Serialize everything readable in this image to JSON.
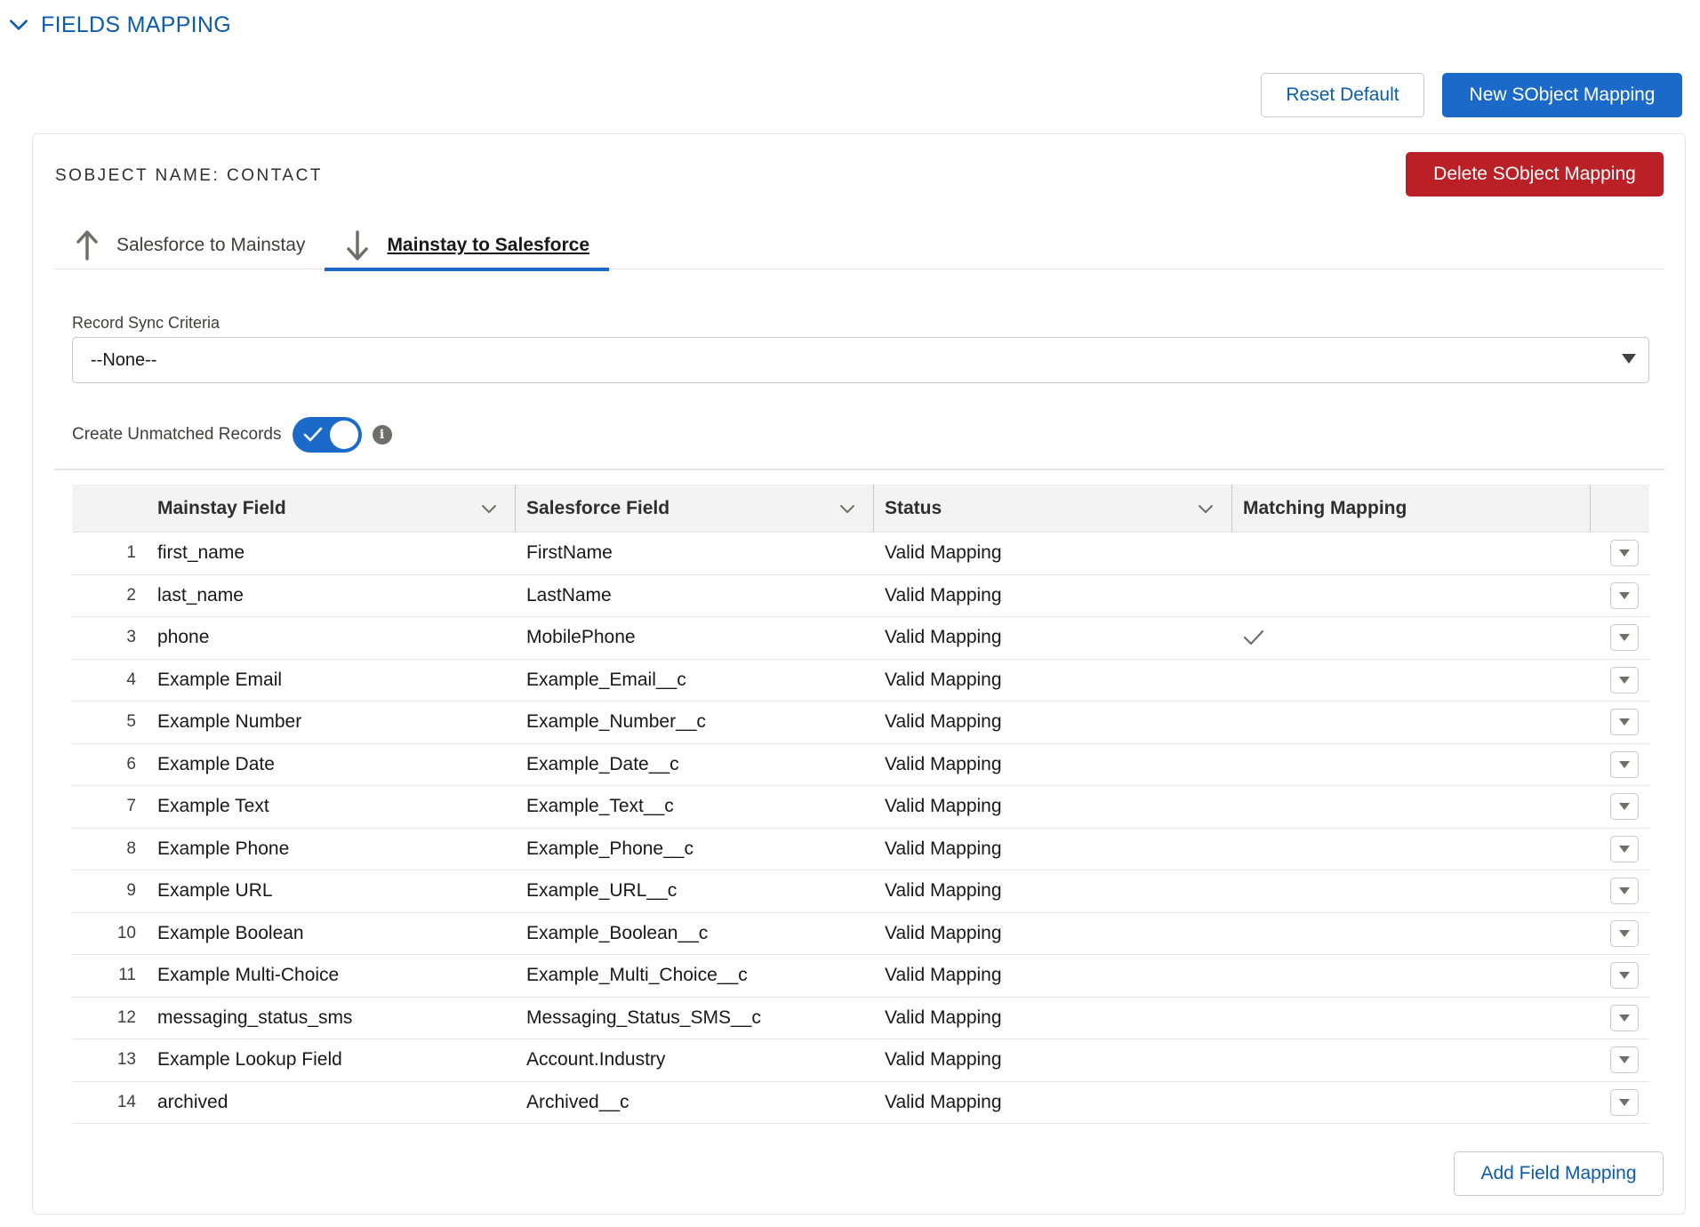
{
  "section": {
    "title": "FIELDS MAPPING",
    "collapse_icon": "chevron-down-icon"
  },
  "toolbar": {
    "reset_label": "Reset Default",
    "new_label": "New SObject Mapping"
  },
  "card": {
    "sobject_title": "SOBJECT NAME: CONTACT",
    "delete_label": "Delete SObject Mapping",
    "tabs": [
      {
        "label": "Salesforce to Mainstay",
        "icon": "arrow-up-icon",
        "active": false
      },
      {
        "label": "Mainstay to Salesforce",
        "icon": "arrow-down-icon",
        "active": true
      }
    ],
    "criteria": {
      "label": "Record Sync Criteria",
      "value": "--None--"
    },
    "unmatched": {
      "label": "Create Unmatched Records",
      "enabled": true
    },
    "add_label": "Add Field Mapping"
  },
  "grid": {
    "columns": [
      "Mainstay Field",
      "Salesforce Field",
      "Status",
      "Matching Mapping"
    ],
    "rows": [
      {
        "num": "1",
        "mainstay": "first_name",
        "salesforce": "FirstName",
        "status": "Valid Mapping",
        "matching": false
      },
      {
        "num": "2",
        "mainstay": "last_name",
        "salesforce": "LastName",
        "status": "Valid Mapping",
        "matching": false
      },
      {
        "num": "3",
        "mainstay": "phone",
        "salesforce": "MobilePhone",
        "status": "Valid Mapping",
        "matching": true
      },
      {
        "num": "4",
        "mainstay": "Example Email",
        "salesforce": "Example_Email__c",
        "status": "Valid Mapping",
        "matching": false
      },
      {
        "num": "5",
        "mainstay": "Example Number",
        "salesforce": "Example_Number__c",
        "status": "Valid Mapping",
        "matching": false
      },
      {
        "num": "6",
        "mainstay": "Example Date",
        "salesforce": "Example_Date__c",
        "status": "Valid Mapping",
        "matching": false
      },
      {
        "num": "7",
        "mainstay": "Example Text",
        "salesforce": "Example_Text__c",
        "status": "Valid Mapping",
        "matching": false
      },
      {
        "num": "8",
        "mainstay": "Example Phone",
        "salesforce": "Example_Phone__c",
        "status": "Valid Mapping",
        "matching": false
      },
      {
        "num": "9",
        "mainstay": "Example URL",
        "salesforce": "Example_URL__c",
        "status": "Valid Mapping",
        "matching": false
      },
      {
        "num": "10",
        "mainstay": "Example Boolean",
        "salesforce": "Example_Boolean__c",
        "status": "Valid Mapping",
        "matching": false
      },
      {
        "num": "11",
        "mainstay": "Example Multi-Choice",
        "salesforce": "Example_Multi_Choice__c",
        "status": "Valid Mapping",
        "matching": false
      },
      {
        "num": "12",
        "mainstay": "messaging_status_sms",
        "salesforce": "Messaging_Status_SMS__c",
        "status": "Valid Mapping",
        "matching": false
      },
      {
        "num": "13",
        "mainstay": "Example Lookup Field",
        "salesforce": "Account.Industry",
        "status": "Valid Mapping",
        "matching": false
      },
      {
        "num": "14",
        "mainstay": "archived",
        "salesforce": "Archived__c",
        "status": "Valid Mapping",
        "matching": false
      }
    ]
  },
  "colors": {
    "brand": "#1b6ac9",
    "link": "#0b5cab",
    "destructive": "#ba2025",
    "border": "#c9c9c9"
  }
}
